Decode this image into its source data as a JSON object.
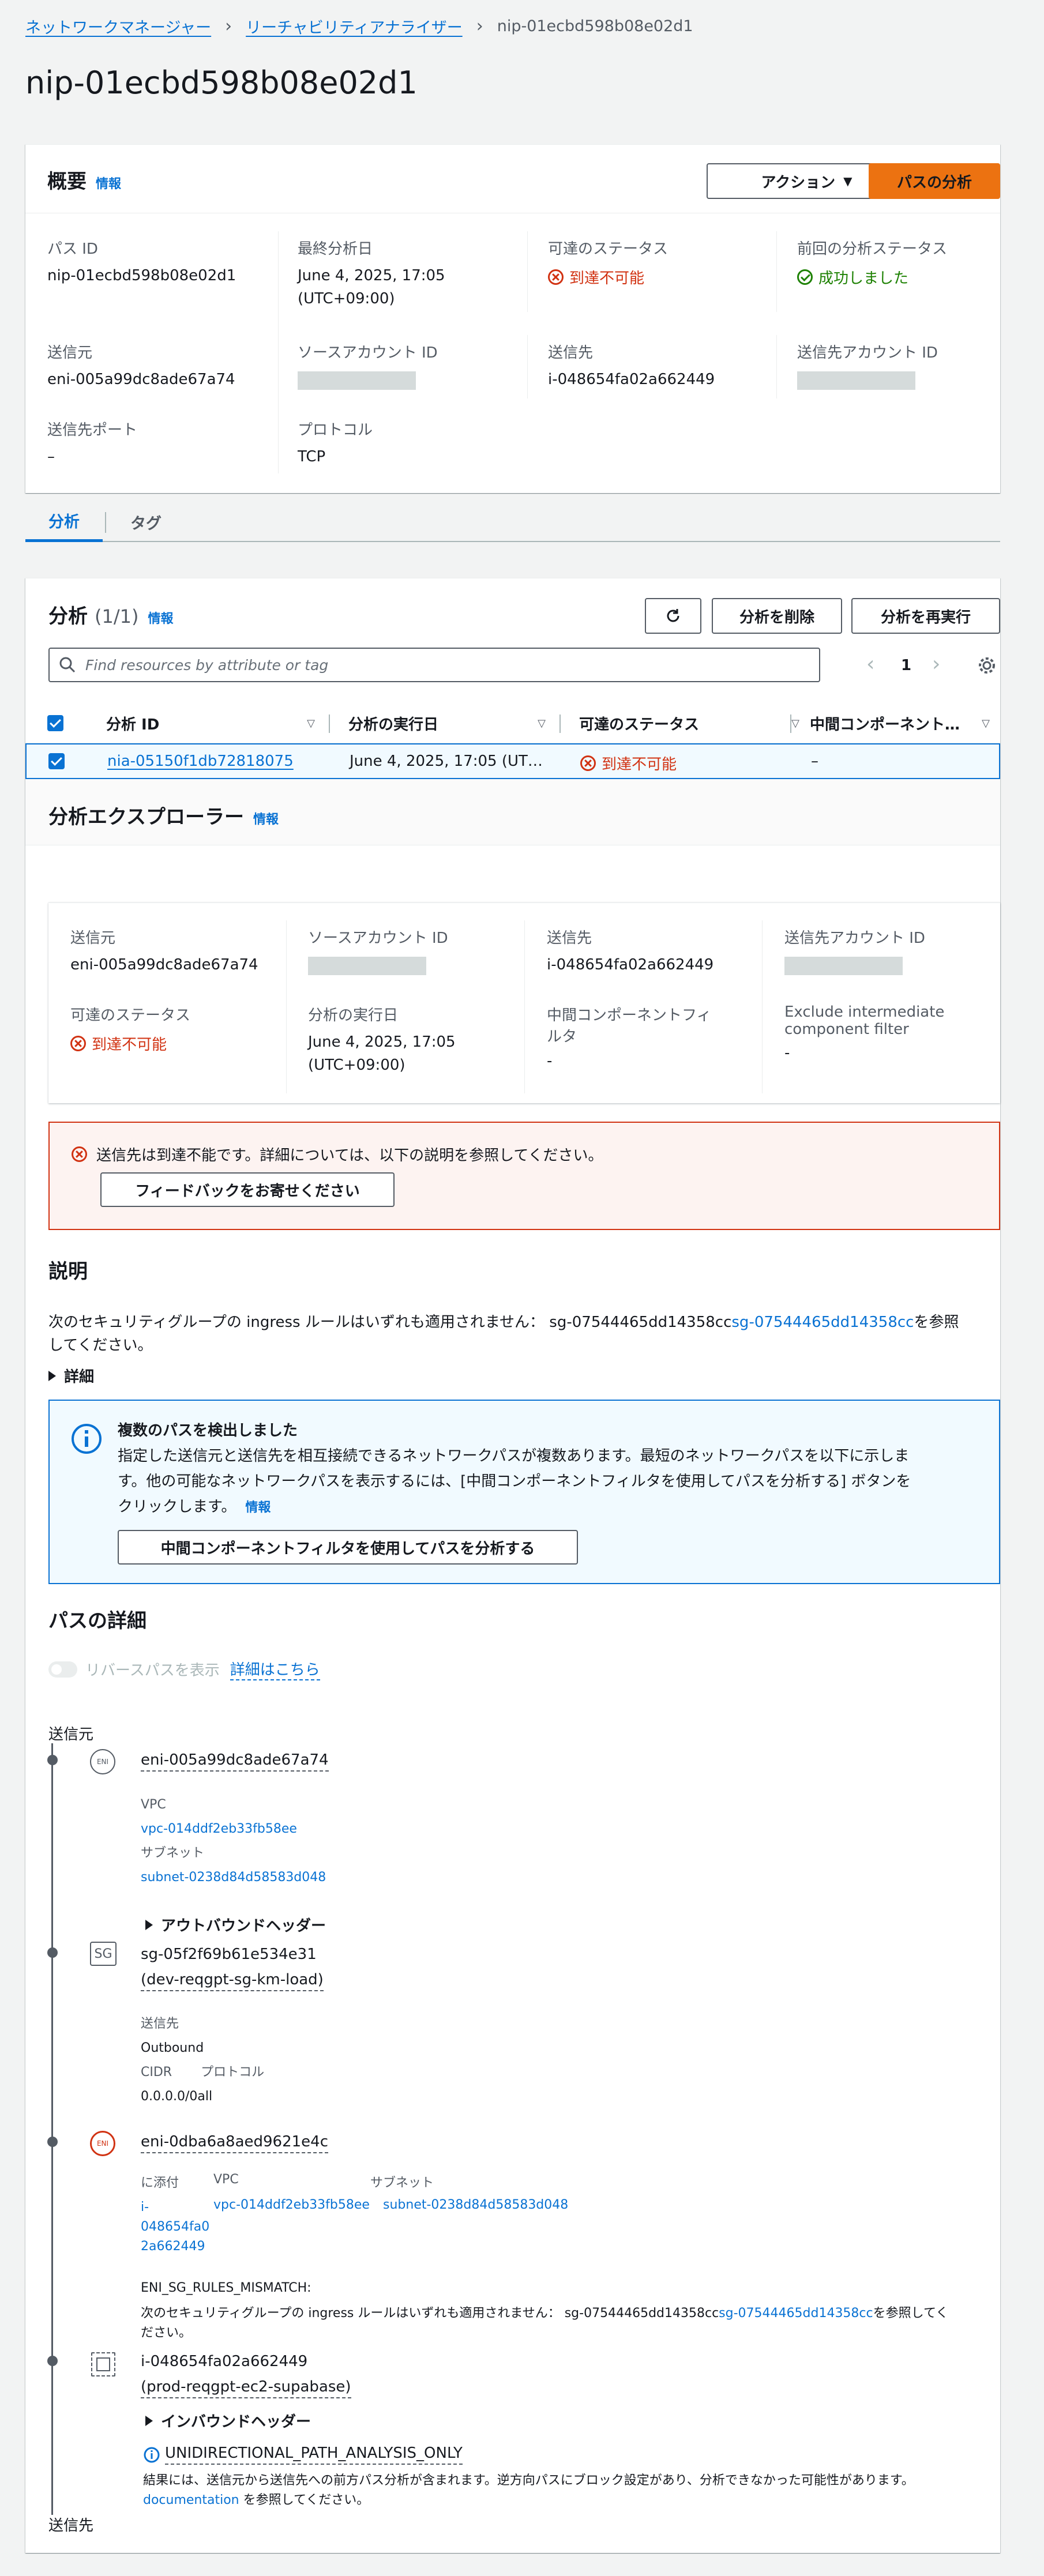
{
  "breadcrumb": {
    "items": [
      "ネットワークマネージャー",
      "リーチャビリティアナライザー",
      "nip-01ecbd598b08e02d1"
    ]
  },
  "page_title": "nip-01ecbd598b08e02d1",
  "overview": {
    "title": "概要",
    "info": "情報",
    "actions_button": "アクション",
    "analyze_button": "パスの分析",
    "fields": {
      "path_id_label": "パス ID",
      "path_id": "nip-01ecbd598b08e02d1",
      "last_analyzed_label": "最終分析日",
      "last_analyzed_1": "June 4, 2025, 17:05",
      "last_analyzed_2": "(UTC+09:00)",
      "reach_status_label": "可達のステータス",
      "reach_status": "到達不可能",
      "prev_status_label": "前回の分析ステータス",
      "prev_status": "成功しました",
      "source_label": "送信元",
      "source": "eni-005a99dc8ade67a74",
      "source_account_label": "ソースアカウント ID",
      "dest_label": "送信先",
      "dest": "i-048654fa02a662449",
      "dest_account_label": "送信先アカウント ID",
      "dest_port_label": "送信先ポート",
      "dest_port": "–",
      "protocol_label": "プロトコル",
      "protocol": "TCP"
    }
  },
  "tabs": [
    {
      "label": "分析"
    },
    {
      "label": "タグ"
    }
  ],
  "analyses": {
    "title": "分析",
    "count": "(1/1)",
    "info": "情報",
    "delete_button": "分析を削除",
    "rerun_button": "分析を再実行",
    "search_placeholder": "Find resources by attribute or tag",
    "page_number": "1",
    "columns": [
      "分析 ID",
      "分析の実行日",
      "可達のステータス",
      "中間コンポーネント…"
    ],
    "rows": [
      {
        "id": "nia-05150f1db72818075",
        "date": "June 4, 2025, 17:05 (UT…",
        "status": "到達不可能",
        "intermediate": "–"
      }
    ]
  },
  "explorer": {
    "title": "分析エクスプローラー",
    "info": "情報",
    "source_label": "送信元",
    "source": "eni-005a99dc8ade67a74",
    "source_account_label": "ソースアカウント ID",
    "dest_label": "送信先",
    "dest": "i-048654fa02a662449",
    "dest_account_label": "送信先アカウント ID",
    "reach_label": "可達のステータス",
    "reach": "到達不可能",
    "run_date_label": "分析の実行日",
    "run_date_1": "June 4, 2025, 17:05",
    "run_date_2": "(UTC+09:00)",
    "filter_label_1": "中間コンポーネントフィ",
    "filter_label_2": "ルタ",
    "filter_value": "-",
    "exclude_label_1": "Exclude intermediate",
    "exclude_label_2": "component filter",
    "exclude_value": "-"
  },
  "error_alert": {
    "message": "送信先は到達不能です。詳細については、以下の説明を参照してください。",
    "feedback_button": "フィードバックをお寄せください"
  },
  "explanation": {
    "title": "説明",
    "text_1": "次のセキュリティグループの ingress ルールはいずれも適用されません： sg-07544465dd14358cc",
    "sg_link": "sg-07544465dd14358cc",
    "text_2": "を参照",
    "text_3": "してください。",
    "details": "詳細"
  },
  "info_alert": {
    "title": "複数のパスを検出しました",
    "line_1": "指定した送信元と送信先を相互接続できるネットワークパスが複数あります。最短のネットワークパスを以下に示しま",
    "line_2": "す。他の可能なネットワークパスを表示するには、[中間コンポーネントフィルタを使用してパスを分析する] ボタンを",
    "line_3": "クリックします。",
    "info": "情報",
    "button": "中間コンポーネントフィルタを使用してパスを分析する"
  },
  "path_details": {
    "title": "パスの詳細",
    "reverse_toggle": "リバースパスを表示",
    "learn_more": "詳細はこちら",
    "source_heading": "送信元",
    "dest_heading": "送信先",
    "node1": {
      "name": "eni-005a99dc8ade67a74",
      "vpc_label": "VPC",
      "vpc": "vpc-014ddf2eb33fb58ee",
      "subnet_label": "サブネット",
      "subnet": "subnet-0238d84d58583d048"
    },
    "outbound_header": "アウトバウンドヘッダー",
    "node2": {
      "name_1": "sg-05f2f69b61e534e31",
      "name_2": "(dev-reqgpt-sg-km-load)",
      "dest_label": "送信先",
      "direction": "Outbound",
      "cidr_label": "CIDR",
      "protocol_label": "プロトコル",
      "cidr": "0.0.0.0/0all"
    },
    "node3": {
      "name": "eni-0dba6a8aed9621e4c",
      "attached_label": "に添付",
      "vpc_label": "VPC",
      "subnet_label": "サブネット",
      "attached_1": "i-",
      "attached_2": "048654fa0",
      "attached_3": "2a662449",
      "vpc": "vpc-014ddf2eb33fb58ee",
      "subnet": "subnet-0238d84d58583d048",
      "mismatch_code": "ENI_SG_RULES_MISMATCH:",
      "mismatch_1": "次のセキュリティグループの ingress ルールはいずれも適用されません： sg-07544465dd14358cc",
      "mismatch_link": "sg-07544465dd14358cc",
      "mismatch_2": "を参照してく",
      "mismatch_3": "ださい。"
    },
    "node4": {
      "name_1": "i-048654fa02a662449",
      "name_2": "(prod-reqgpt-ec2-supabase)"
    },
    "inbound_header": "インバウンドヘッダー",
    "uni_code": "UNIDIRECTIONAL_PATH_ANALYSIS_ONLY",
    "uni_text_1": "結果には、送信元から送信先への前方パス分析が含まれます。逆方向パスにブロック設定があり、分析できなかった可能性があります。",
    "uni_link": "documentation",
    "uni_text_2": " を参照してください。"
  },
  "colors": {
    "link": "#0972d3",
    "error": "#d13212",
    "success": "#1d8102",
    "primary": "#ec7211",
    "info_bg": "#f1faff"
  }
}
